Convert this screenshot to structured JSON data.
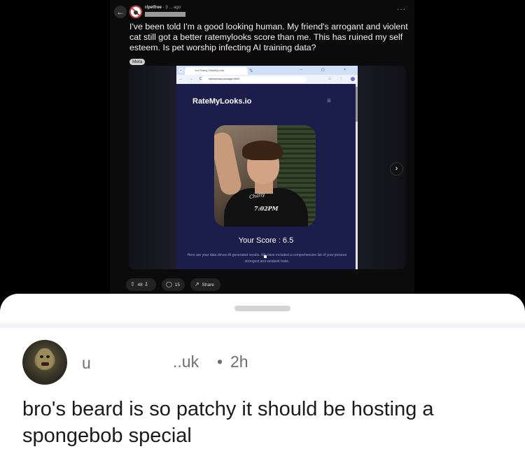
{
  "post": {
    "back_icon": "←",
    "subreddit": "r/petfree",
    "meta": "· 3 ... ago",
    "more_icon": "···",
    "title": "I've been told I'm a good looking human. My friend's arrogant and violent cat still got a better ratemylooks score than me. This has ruined my self esteem. Is pet worship infecting AI training data?",
    "flair": "Meta",
    "next_icon": "›"
  },
  "browser": {
    "tab_title": "Your Rating | RateMyLooks",
    "tab_close": "×",
    "tab_plus": "+",
    "window_controls": "– ▢ ×",
    "nav_icons": "← → C",
    "url": "ratemylooks.io/image/1954/",
    "addr_icons": "☆ ⋮"
  },
  "site": {
    "logo": "RateMyLooks.io",
    "menu_icon": "≡",
    "photo_signature": "Chaliy",
    "photo_time": "7:02PM",
    "score_text": "Your Score : 6.5",
    "description": "Here are your data driven AI generated results. We have included a comprehensive list of your pictures strongest and weakest traits."
  },
  "actions": {
    "votes": "48",
    "comments": "15",
    "share": "Share",
    "upvote_icon": "⇧",
    "downvote_icon": "⇩",
    "comment_icon": "◯",
    "share_icon": "↗"
  },
  "comment": {
    "user_part1": "u",
    "user_part2": "..uk",
    "separator": "•",
    "time": "2h",
    "body": "bro's beard is so patchy it should be hosting a spongebob special"
  }
}
